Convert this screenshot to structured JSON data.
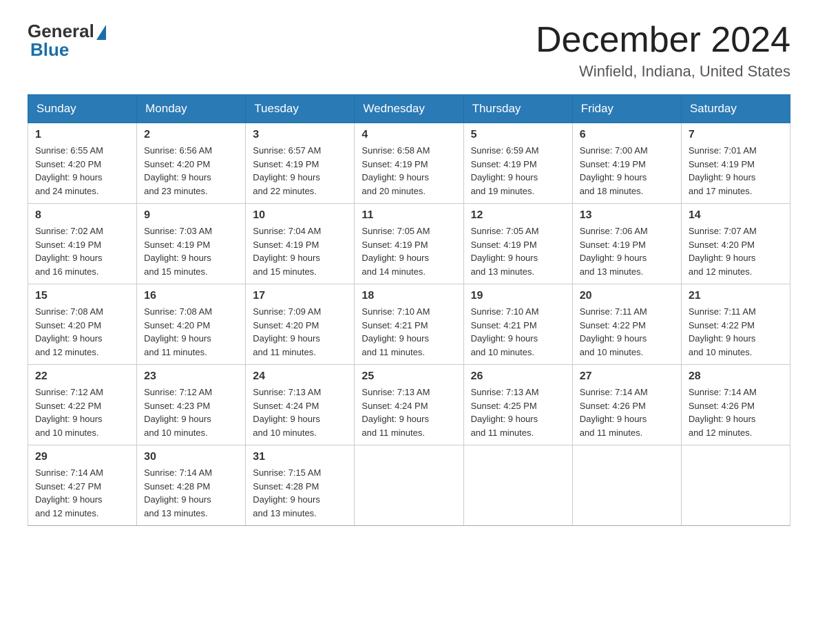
{
  "header": {
    "logo_general": "General",
    "logo_blue": "Blue",
    "month_title": "December 2024",
    "location": "Winfield, Indiana, United States"
  },
  "weekdays": [
    "Sunday",
    "Monday",
    "Tuesday",
    "Wednesday",
    "Thursday",
    "Friday",
    "Saturday"
  ],
  "weeks": [
    [
      {
        "day": "1",
        "sunrise": "6:55 AM",
        "sunset": "4:20 PM",
        "daylight": "9 hours and 24 minutes."
      },
      {
        "day": "2",
        "sunrise": "6:56 AM",
        "sunset": "4:20 PM",
        "daylight": "9 hours and 23 minutes."
      },
      {
        "day": "3",
        "sunrise": "6:57 AM",
        "sunset": "4:19 PM",
        "daylight": "9 hours and 22 minutes."
      },
      {
        "day": "4",
        "sunrise": "6:58 AM",
        "sunset": "4:19 PM",
        "daylight": "9 hours and 20 minutes."
      },
      {
        "day": "5",
        "sunrise": "6:59 AM",
        "sunset": "4:19 PM",
        "daylight": "9 hours and 19 minutes."
      },
      {
        "day": "6",
        "sunrise": "7:00 AM",
        "sunset": "4:19 PM",
        "daylight": "9 hours and 18 minutes."
      },
      {
        "day": "7",
        "sunrise": "7:01 AM",
        "sunset": "4:19 PM",
        "daylight": "9 hours and 17 minutes."
      }
    ],
    [
      {
        "day": "8",
        "sunrise": "7:02 AM",
        "sunset": "4:19 PM",
        "daylight": "9 hours and 16 minutes."
      },
      {
        "day": "9",
        "sunrise": "7:03 AM",
        "sunset": "4:19 PM",
        "daylight": "9 hours and 15 minutes."
      },
      {
        "day": "10",
        "sunrise": "7:04 AM",
        "sunset": "4:19 PM",
        "daylight": "9 hours and 15 minutes."
      },
      {
        "day": "11",
        "sunrise": "7:05 AM",
        "sunset": "4:19 PM",
        "daylight": "9 hours and 14 minutes."
      },
      {
        "day": "12",
        "sunrise": "7:05 AM",
        "sunset": "4:19 PM",
        "daylight": "9 hours and 13 minutes."
      },
      {
        "day": "13",
        "sunrise": "7:06 AM",
        "sunset": "4:19 PM",
        "daylight": "9 hours and 13 minutes."
      },
      {
        "day": "14",
        "sunrise": "7:07 AM",
        "sunset": "4:20 PM",
        "daylight": "9 hours and 12 minutes."
      }
    ],
    [
      {
        "day": "15",
        "sunrise": "7:08 AM",
        "sunset": "4:20 PM",
        "daylight": "9 hours and 12 minutes."
      },
      {
        "day": "16",
        "sunrise": "7:08 AM",
        "sunset": "4:20 PM",
        "daylight": "9 hours and 11 minutes."
      },
      {
        "day": "17",
        "sunrise": "7:09 AM",
        "sunset": "4:20 PM",
        "daylight": "9 hours and 11 minutes."
      },
      {
        "day": "18",
        "sunrise": "7:10 AM",
        "sunset": "4:21 PM",
        "daylight": "9 hours and 11 minutes."
      },
      {
        "day": "19",
        "sunrise": "7:10 AM",
        "sunset": "4:21 PM",
        "daylight": "9 hours and 10 minutes."
      },
      {
        "day": "20",
        "sunrise": "7:11 AM",
        "sunset": "4:22 PM",
        "daylight": "9 hours and 10 minutes."
      },
      {
        "day": "21",
        "sunrise": "7:11 AM",
        "sunset": "4:22 PM",
        "daylight": "9 hours and 10 minutes."
      }
    ],
    [
      {
        "day": "22",
        "sunrise": "7:12 AM",
        "sunset": "4:22 PM",
        "daylight": "9 hours and 10 minutes."
      },
      {
        "day": "23",
        "sunrise": "7:12 AM",
        "sunset": "4:23 PM",
        "daylight": "9 hours and 10 minutes."
      },
      {
        "day": "24",
        "sunrise": "7:13 AM",
        "sunset": "4:24 PM",
        "daylight": "9 hours and 10 minutes."
      },
      {
        "day": "25",
        "sunrise": "7:13 AM",
        "sunset": "4:24 PM",
        "daylight": "9 hours and 11 minutes."
      },
      {
        "day": "26",
        "sunrise": "7:13 AM",
        "sunset": "4:25 PM",
        "daylight": "9 hours and 11 minutes."
      },
      {
        "day": "27",
        "sunrise": "7:14 AM",
        "sunset": "4:26 PM",
        "daylight": "9 hours and 11 minutes."
      },
      {
        "day": "28",
        "sunrise": "7:14 AM",
        "sunset": "4:26 PM",
        "daylight": "9 hours and 12 minutes."
      }
    ],
    [
      {
        "day": "29",
        "sunrise": "7:14 AM",
        "sunset": "4:27 PM",
        "daylight": "9 hours and 12 minutes."
      },
      {
        "day": "30",
        "sunrise": "7:14 AM",
        "sunset": "4:28 PM",
        "daylight": "9 hours and 13 minutes."
      },
      {
        "day": "31",
        "sunrise": "7:15 AM",
        "sunset": "4:28 PM",
        "daylight": "9 hours and 13 minutes."
      },
      null,
      null,
      null,
      null
    ]
  ],
  "labels": {
    "sunrise": "Sunrise:",
    "sunset": "Sunset:",
    "daylight": "Daylight:"
  }
}
